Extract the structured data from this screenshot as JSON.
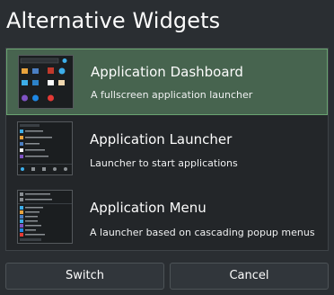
{
  "dialog": {
    "title": "Alternative Widgets"
  },
  "widgets": [
    {
      "name": "Application Dashboard",
      "description": "A fullscreen application launcher",
      "selected": true,
      "thumb_search": "Search..."
    },
    {
      "name": "Application Launcher",
      "description": "Launcher to start applications",
      "selected": false
    },
    {
      "name": "Application Menu",
      "description": "A launcher based on cascading popup menus",
      "selected": false
    }
  ],
  "buttons": {
    "switch_label": "Switch",
    "cancel_label": "Cancel"
  },
  "colors": {
    "background": "#2a2e32",
    "selection": "#47644f",
    "selection_border": "#6aa471"
  }
}
